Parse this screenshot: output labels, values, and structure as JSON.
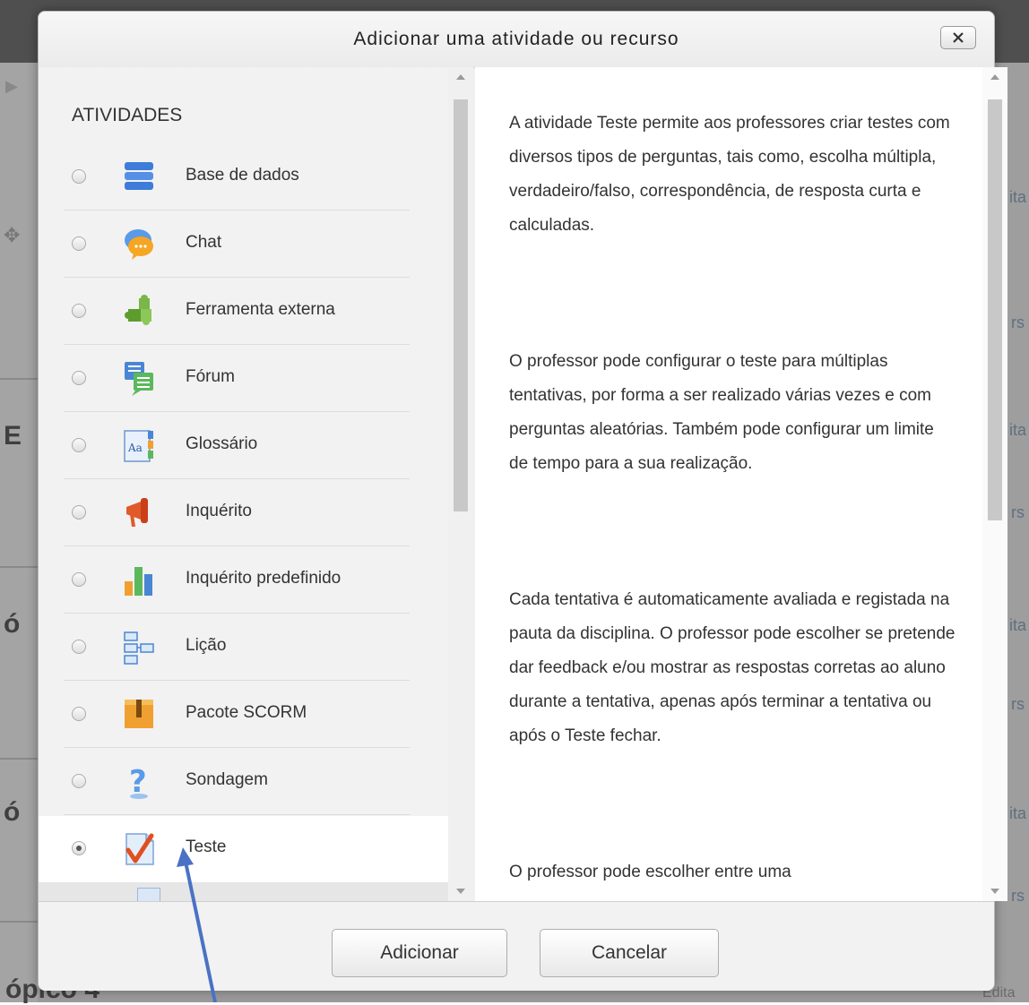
{
  "modal": {
    "title": "Adicionar uma atividade ou recurso",
    "close_icon": "close-x-icon"
  },
  "activities": {
    "heading": "ATIVIDADES",
    "items": [
      {
        "label": "Base de dados",
        "icon": "database-icon",
        "selected": false
      },
      {
        "label": "Chat",
        "icon": "chat-bubble-icon",
        "selected": false
      },
      {
        "label": "Ferramenta externa",
        "icon": "puzzle-icon",
        "selected": false
      },
      {
        "label": "Fórum",
        "icon": "forum-icon",
        "selected": false
      },
      {
        "label": "Glossário",
        "icon": "glossary-icon",
        "selected": false
      },
      {
        "label": "Inquérito",
        "icon": "megaphone-icon",
        "selected": false
      },
      {
        "label": "Inquérito predefinido",
        "icon": "bar-chart-icon",
        "selected": false
      },
      {
        "label": "Lição",
        "icon": "lesson-tree-icon",
        "selected": false
      },
      {
        "label": "Pacote SCORM",
        "icon": "package-icon",
        "selected": false
      },
      {
        "label": "Sondagem",
        "icon": "question-mark-icon",
        "selected": false
      },
      {
        "label": "Teste",
        "icon": "quiz-check-icon",
        "selected": true
      }
    ]
  },
  "help": {
    "paragraphs": [
      "A atividade Teste permite aos professores criar testes com diversos tipos de perguntas, tais como, escolha múltipla, verdadeiro/falso, correspondência, de resposta curta e calculadas.",
      "O professor pode configurar o teste para múltiplas tentativas, por forma a ser realizado várias vezes e com perguntas aleatórias. Também pode configurar um limite de tempo para a sua realização.",
      "Cada tentativa é automaticamente avaliada e registada na pauta da disciplina. O professor pode escolher se pretende dar feedback e/ou mostrar as respostas corretas ao aluno durante a tentativa, apenas após terminar a tentativa ou após o Teste fechar.",
      "O professor pode escolher entre uma"
    ]
  },
  "footer": {
    "add_label": "Adicionar",
    "cancel_label": "Cancelar"
  },
  "background": {
    "letters": [
      "E",
      "ó",
      "ó"
    ],
    "right_fragments": [
      "ita",
      "rs",
      "ita",
      "rs",
      "ita",
      "rs",
      "ita",
      "rs"
    ],
    "bottom_left": "ópico 4",
    "bottom_right": "Edita"
  },
  "colors": {
    "annotation_arrow": "#4a72c4",
    "selected_row": "#ffffff"
  }
}
